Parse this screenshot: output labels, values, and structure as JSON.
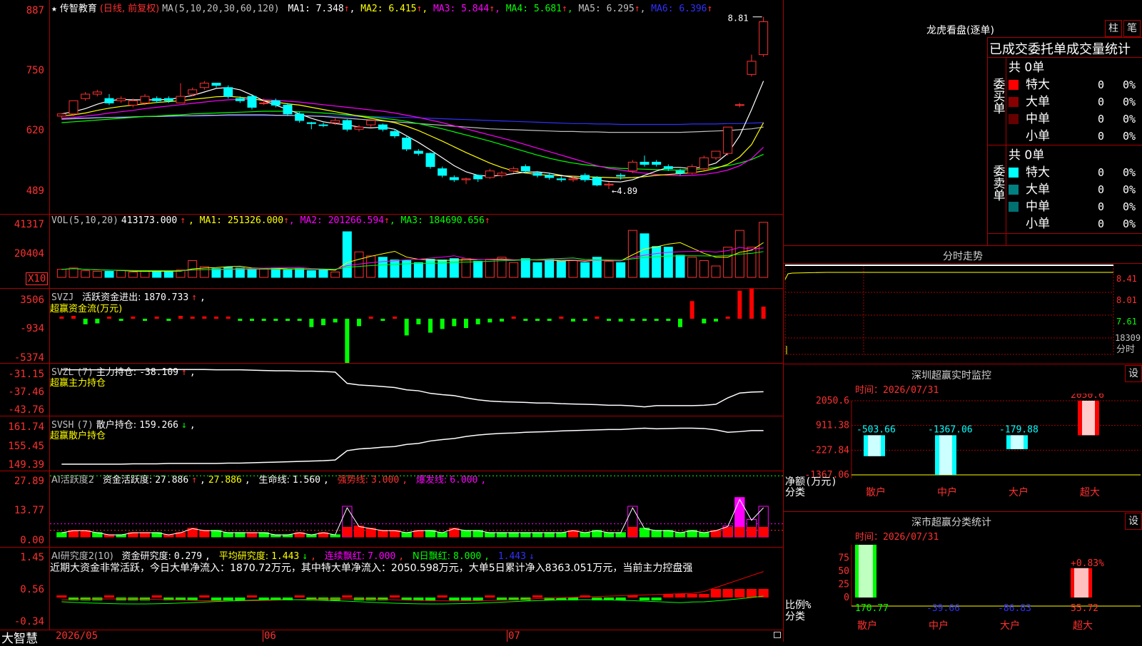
{
  "stock": {
    "star": "★",
    "name": "传智教育",
    "mode": "(日线, 前复权)",
    "ma_params": "MA(5,10,20,30,60,120)",
    "ma": [
      {
        "label": "MA1:",
        "value": "7.348",
        "color": "#ffffff"
      },
      {
        "label": "MA2:",
        "value": "6.415",
        "color": "#ffff00"
      },
      {
        "label": "MA3:",
        "value": "5.844",
        "color": "#ff00ff"
      },
      {
        "label": "MA4:",
        "value": "5.681",
        "color": "#00ff00"
      },
      {
        "label": "MA5:",
        "value": "6.295",
        "color": "#c0c0c0"
      },
      {
        "label": "MA6:",
        "value": "6.396",
        "color": "#3030ff"
      }
    ],
    "up_arrow": "↑",
    "high_label": "8.81",
    "low_label": "←4.89"
  },
  "price_axis": {
    "max_label": "887",
    "labels": [
      "750",
      "620",
      "489"
    ]
  },
  "candles": [
    [
      6.55,
      6.6,
      6.6,
      6.5
    ],
    [
      6.6,
      6.9,
      6.9,
      6.55
    ],
    [
      6.95,
      7.05,
      7.1,
      6.9
    ],
    [
      7.05,
      7.1,
      7.15,
      7.0
    ],
    [
      6.95,
      6.85,
      7.05,
      6.8
    ],
    [
      6.9,
      6.95,
      7.0,
      6.85
    ],
    [
      6.8,
      6.9,
      6.95,
      6.75
    ],
    [
      6.85,
      7.0,
      7.05,
      6.8
    ],
    [
      6.95,
      6.9,
      7.0,
      6.85
    ],
    [
      6.95,
      6.9,
      7.0,
      6.85
    ],
    [
      6.85,
      7.0,
      7.3,
      6.85
    ],
    [
      7.05,
      7.15,
      7.2,
      7.0
    ],
    [
      7.2,
      7.3,
      7.35,
      7.15
    ],
    [
      7.3,
      7.25,
      7.3,
      7.2
    ],
    [
      7.2,
      7.0,
      7.25,
      6.95
    ],
    [
      6.95,
      6.9,
      7.0,
      6.85
    ],
    [
      7.0,
      6.75,
      7.05,
      6.7
    ],
    [
      6.85,
      6.85,
      6.95,
      6.8
    ],
    [
      6.9,
      6.8,
      6.95,
      6.75
    ],
    [
      6.8,
      6.6,
      6.85,
      6.55
    ],
    [
      6.6,
      6.45,
      6.65,
      6.4
    ],
    [
      6.4,
      6.38,
      6.42,
      6.25
    ],
    [
      6.35,
      6.34,
      6.4,
      6.3
    ],
    [
      6.4,
      6.45,
      6.5,
      6.35
    ],
    [
      6.45,
      6.25,
      6.48,
      6.2
    ],
    [
      6.25,
      6.3,
      6.35,
      6.2
    ],
    [
      6.35,
      6.45,
      6.45,
      6.3
    ],
    [
      6.35,
      6.25,
      6.38,
      6.2
    ],
    [
      6.2,
      6.1,
      6.25,
      6.05
    ],
    [
      6.05,
      5.8,
      6.1,
      5.75
    ],
    [
      5.75,
      5.7,
      5.8,
      5.65
    ],
    [
      5.7,
      5.4,
      5.72,
      5.35
    ],
    [
      5.35,
      5.2,
      5.4,
      5.15
    ],
    [
      5.15,
      5.1,
      5.2,
      5.05
    ],
    [
      5.1,
      5.12,
      5.15,
      5.0
    ],
    [
      5.2,
      5.12,
      5.22,
      5.05
    ],
    [
      5.15,
      5.3,
      5.35,
      5.12
    ],
    [
      5.2,
      5.25,
      5.3,
      5.15
    ],
    [
      5.3,
      5.35,
      5.4,
      5.25
    ],
    [
      5.4,
      5.3,
      5.45,
      5.25
    ],
    [
      5.25,
      5.2,
      5.3,
      5.15
    ],
    [
      5.2,
      5.15,
      5.25,
      5.1
    ],
    [
      5.12,
      5.1,
      5.18,
      5.05
    ],
    [
      5.1,
      5.12,
      5.2,
      5.05
    ],
    [
      5.2,
      5.1,
      5.25,
      5.05
    ],
    [
      5.15,
      4.98,
      5.18,
      4.95
    ],
    [
      4.98,
      5.0,
      5.05,
      4.89
    ],
    [
      5.2,
      5.18,
      5.25,
      5.1
    ],
    [
      5.3,
      5.5,
      5.55,
      5.25
    ],
    [
      5.5,
      5.45,
      5.65,
      5.4
    ],
    [
      5.5,
      5.45,
      5.55,
      5.4
    ],
    [
      5.4,
      5.35,
      5.45,
      5.3
    ],
    [
      5.3,
      5.25,
      5.35,
      5.2
    ],
    [
      5.25,
      5.4,
      5.45,
      5.22
    ],
    [
      5.35,
      5.6,
      5.65,
      5.3
    ],
    [
      5.6,
      5.75,
      5.75,
      5.55
    ],
    [
      5.7,
      6.3,
      6.3,
      5.65
    ],
    [
      6.8,
      6.81,
      6.85,
      6.75
    ],
    [
      7.5,
      7.8,
      7.95,
      7.45
    ],
    [
      7.95,
      8.7,
      8.81,
      7.9
    ]
  ],
  "candle_colors": {
    "up": "#ff3030",
    "down": "#00ffff"
  },
  "ma_lines": {
    "ma1": [
      6.6,
      6.65,
      6.72,
      6.82,
      6.9,
      6.93,
      6.92,
      6.92,
      6.92,
      6.93,
      6.97,
      7.02,
      7.1,
      7.18,
      7.2,
      7.15,
      7.03,
      6.9,
      6.8,
      6.7,
      6.6,
      6.5,
      6.42,
      6.38,
      6.35,
      6.3,
      6.28,
      6.3,
      6.25,
      6.1,
      5.95,
      5.78,
      5.6,
      5.42,
      5.28,
      5.2,
      5.18,
      5.2,
      5.24,
      5.27,
      5.28,
      5.25,
      5.2,
      5.15,
      5.12,
      5.09,
      5.06,
      5.05,
      5.1,
      5.2,
      5.3,
      5.38,
      5.38,
      5.35,
      5.4,
      5.48,
      5.7,
      6.1,
      6.7,
      7.35
    ],
    "ma2": [
      6.55,
      6.58,
      6.62,
      6.68,
      6.73,
      6.77,
      6.8,
      6.83,
      6.86,
      6.88,
      6.9,
      6.93,
      6.96,
      6.99,
      7.0,
      6.98,
      6.95,
      6.9,
      6.87,
      6.83,
      6.8,
      6.75,
      6.7,
      6.65,
      6.6,
      6.55,
      6.5,
      6.45,
      6.4,
      6.32,
      6.22,
      6.1,
      5.98,
      5.85,
      5.72,
      5.6,
      5.48,
      5.38,
      5.3,
      5.25,
      5.22,
      5.2,
      5.19,
      5.18,
      5.17,
      5.16,
      5.15,
      5.14,
      5.15,
      5.17,
      5.2,
      5.22,
      5.24,
      5.26,
      5.3,
      5.36,
      5.45,
      5.62,
      5.9,
      6.4
    ],
    "ma3": [
      6.5,
      6.52,
      6.55,
      6.58,
      6.62,
      6.65,
      6.68,
      6.72,
      6.75,
      6.78,
      6.81,
      6.84,
      6.87,
      6.9,
      6.92,
      6.93,
      6.93,
      6.92,
      6.91,
      6.89,
      6.87,
      6.84,
      6.81,
      6.78,
      6.75,
      6.72,
      6.69,
      6.66,
      6.62,
      6.57,
      6.52,
      6.46,
      6.4,
      6.33,
      6.26,
      6.19,
      6.12,
      6.05,
      5.98,
      5.9,
      5.82,
      5.74,
      5.66,
      5.58,
      5.5,
      5.42,
      5.36,
      5.32,
      5.28,
      5.25,
      5.22,
      5.2,
      5.19,
      5.2,
      5.22,
      5.26,
      5.32,
      5.42,
      5.58,
      5.84
    ],
    "ma4": [
      6.4,
      6.42,
      6.44,
      6.46,
      6.48,
      6.5,
      6.52,
      6.54,
      6.55,
      6.57,
      6.58,
      6.6,
      6.61,
      6.62,
      6.63,
      6.64,
      6.65,
      6.66,
      6.66,
      6.66,
      6.65,
      6.64,
      6.62,
      6.6,
      6.58,
      6.56,
      6.53,
      6.5,
      6.47,
      6.43,
      6.38,
      6.32,
      6.26,
      6.19,
      6.12,
      6.05,
      5.98,
      5.9,
      5.82,
      5.74,
      5.66,
      5.59,
      5.53,
      5.48,
      5.44,
      5.41,
      5.38,
      5.36,
      5.35,
      5.34,
      5.33,
      5.32,
      5.32,
      5.33,
      5.35,
      5.38,
      5.42,
      5.48,
      5.56,
      5.68
    ],
    "ma5": [
      6.48,
      6.49,
      6.5,
      6.51,
      6.52,
      6.52,
      6.53,
      6.54,
      6.54,
      6.55,
      6.56,
      6.56,
      6.57,
      6.57,
      6.58,
      6.58,
      6.58,
      6.58,
      6.57,
      6.57,
      6.56,
      6.55,
      6.54,
      6.52,
      6.5,
      6.48,
      6.46,
      6.44,
      6.42,
      6.4,
      6.38,
      6.36,
      6.34,
      6.32,
      6.3,
      6.28,
      6.26,
      6.25,
      6.24,
      6.23,
      6.22,
      6.21,
      6.2,
      6.2,
      6.19,
      6.19,
      6.18,
      6.18,
      6.18,
      6.18,
      6.18,
      6.18,
      6.18,
      6.19,
      6.2,
      6.21,
      6.22,
      6.24,
      6.26,
      6.3
    ],
    "ma6": [
      6.5,
      6.51,
      6.51,
      6.52,
      6.52,
      6.53,
      6.53,
      6.54,
      6.54,
      6.54,
      6.55,
      6.55,
      6.55,
      6.56,
      6.56,
      6.56,
      6.56,
      6.56,
      6.56,
      6.56,
      6.56,
      6.56,
      6.55,
      6.55,
      6.55,
      6.54,
      6.54,
      6.53,
      6.52,
      6.52,
      6.51,
      6.5,
      6.49,
      6.48,
      6.47,
      6.46,
      6.45,
      6.44,
      6.43,
      6.42,
      6.41,
      6.4,
      6.39,
      6.38,
      6.38,
      6.37,
      6.37,
      6.36,
      6.36,
      6.36,
      6.36,
      6.36,
      6.36,
      6.37,
      6.37,
      6.37,
      6.38,
      6.38,
      6.39,
      6.4
    ]
  },
  "vol": {
    "params": "VOL(5,10,20)",
    "value": "413173.000",
    "ma": [
      {
        "label": "MA1:",
        "value": "251326.000",
        "color": "#ffff00"
      },
      {
        "label": "MA2:",
        "value": "201266.594",
        "color": "#ff00ff"
      },
      {
        "label": "MA3:",
        "value": "184690.656",
        "color": "#00ff00"
      }
    ],
    "axis": [
      "41317",
      "20404"
    ],
    "unit": "X10",
    "bars": [
      12,
      14,
      10,
      9,
      9,
      10,
      8,
      9,
      10,
      8,
      11,
      25,
      16,
      13,
      15,
      14,
      12,
      13,
      14,
      11,
      13,
      10,
      11,
      8,
      68,
      38,
      32,
      30,
      26,
      25,
      22,
      27,
      26,
      28,
      28,
      24,
      27,
      30,
      22,
      28,
      22,
      27,
      24,
      25,
      22,
      30,
      24,
      22,
      70,
      65,
      46,
      45,
      33,
      30,
      25,
      17,
      45,
      70,
      45,
      82
    ]
  },
  "svzj": {
    "name": "SVZJ",
    "label": "活跃资金进出:",
    "value": "1870.733",
    "suffix": ",",
    "sub": "超赢资金流(万元)",
    "axis": [
      "3506",
      "-934",
      "-5374"
    ],
    "values": [
      200,
      300,
      -600,
      -500,
      100,
      -200,
      150,
      -100,
      150,
      -200,
      300,
      150,
      250,
      200,
      150,
      -200,
      -150,
      -100,
      -100,
      -100,
      -50,
      -900,
      -700,
      -400,
      -5000,
      -800,
      200,
      -200,
      200,
      -1800,
      -600,
      -1500,
      -1100,
      -800,
      -1000,
      -600,
      -400,
      -300,
      100,
      -200,
      -100,
      -200,
      150,
      -300,
      -150,
      200,
      -200,
      -300,
      -100,
      -100,
      -150,
      -100,
      -900,
      1900,
      -500,
      -300,
      100,
      3000,
      3800,
      1300,
      -400,
      2000
    ]
  },
  "svzl": {
    "name": "SVZL",
    "params": "(7)",
    "label": "主力持仓:",
    "value": "-38.109",
    "sub": "超赢主力持仓",
    "axis": [
      "-31.15",
      "-37.46",
      "-43.76"
    ],
    "values": [
      -31.3,
      -31.3,
      -31.3,
      -31.3,
      -31.3,
      -31.3,
      -31.3,
      -31.3,
      -31.3,
      -31.2,
      -31.2,
      -31.2,
      -31.2,
      -31.3,
      -31.3,
      -31.3,
      -31.4,
      -31.5,
      -31.6,
      -31.6,
      -31.7,
      -31.7,
      -31.8,
      -32.0,
      -35.5,
      -36.0,
      -36.2,
      -36.5,
      -36.8,
      -37.5,
      -37.8,
      -38.6,
      -39.0,
      -39.3,
      -40.0,
      -40.6,
      -41.0,
      -41.2,
      -41.3,
      -41.4,
      -41.6,
      -41.6,
      -41.8,
      -41.9,
      -42.0,
      -42.1,
      -42.3,
      -42.3,
      -42.5,
      -42.8,
      -42.4,
      -42.4,
      -42.4,
      -42.4,
      -42.3,
      -42.0,
      -40.0,
      -38.5,
      -38.2,
      -38.1
    ]
  },
  "svsh": {
    "name": "SVSH",
    "params": "(7)",
    "label": "散户持仓:",
    "value": "159.266",
    "sub": "超赢散户持仓",
    "axis": [
      "161.74",
      "155.45",
      "149.39"
    ],
    "values": [
      149.6,
      149.6,
      149.6,
      149.6,
      149.6,
      149.6,
      149.7,
      149.7,
      149.7,
      149.8,
      149.8,
      149.8,
      149.8,
      149.8,
      149.9,
      149.9,
      150.0,
      150.1,
      150.2,
      150.3,
      150.4,
      150.5,
      150.6,
      150.8,
      153.5,
      154.0,
      154.2,
      154.5,
      154.7,
      155.3,
      155.6,
      156.3,
      156.7,
      157.0,
      157.6,
      158.0,
      158.3,
      158.5,
      158.6,
      158.8,
      158.9,
      159.0,
      159.2,
      159.3,
      159.4,
      159.5,
      159.6,
      159.6,
      159.8,
      160.0,
      159.8,
      159.9,
      160.0,
      160.0,
      159.9,
      159.5,
      158.8,
      159.0,
      159.3,
      159.3
    ]
  },
  "ai_active": {
    "name": "AI活跃度2",
    "label": "资金活跃度:",
    "value1": "27.886",
    "value2": "27.886",
    "life_label": "生命线:",
    "life_value": "1.560",
    "strong_label": "强势线:",
    "strong_value": "3.000",
    "burst_label": "爆发线:",
    "burst_value": "6.000",
    "axis": [
      "27.89",
      "13.77",
      "0.00"
    ],
    "values": [
      2,
      3,
      3,
      2,
      1,
      1,
      2,
      2,
      2,
      1,
      2,
      4,
      3,
      3,
      2,
      2,
      2,
      2,
      1,
      1,
      2,
      1,
      2,
      1,
      14,
      5,
      4,
      3,
      3,
      2,
      3,
      3,
      2,
      4,
      3,
      3,
      2,
      2,
      2,
      2,
      2,
      2,
      2,
      3,
      2,
      3,
      2,
      2,
      14,
      4,
      3,
      3,
      2,
      3,
      2,
      3,
      5,
      18,
      8,
      14,
      28
    ],
    "mode": [
      0,
      1,
      1,
      0,
      1,
      0,
      1,
      1,
      0,
      1,
      1,
      1,
      1,
      0,
      0,
      0,
      1,
      0,
      0,
      0,
      1,
      0,
      1,
      0,
      2,
      1,
      1,
      1,
      1,
      0,
      1,
      0,
      0,
      1,
      0,
      0,
      0,
      0,
      0,
      0,
      0,
      0,
      0,
      1,
      0,
      0,
      0,
      0,
      2,
      0,
      0,
      0,
      0,
      0,
      0,
      1,
      2,
      2,
      2,
      2,
      2
    ]
  },
  "ai_research": {
    "name": "AI研究度2(10)",
    "label": "资金研究度:",
    "value": "0.279",
    "avg_label": "平均研究度:",
    "avg_value": "1.443",
    "red_label": "连续飘红:",
    "red_value": "7.000",
    "nred_label": "N日飘红:",
    "nred_value": "8.000",
    "tail_value": "1.443",
    "down_arrow": "↓",
    "comment": "近期大资金非常活跃，今日大单净流入：1870.72万元，其中特大单净流入：2050.598万元，大单5日累计净入8363.051万元，当前主力控盘强",
    "axis": [
      "1.45",
      "0.56",
      "-0.34"
    ]
  },
  "bottom_bar": {
    "brand": "大智慧",
    "dates": [
      "2026/05",
      "06",
      "07"
    ]
  },
  "right_panel": {
    "buttons": [
      "柱",
      "笔"
    ],
    "title": "龙虎看盘(逐单)",
    "stats_title": "已成交委托单成交量统计",
    "buy": {
      "side_label": "委买单",
      "total": "共 0单",
      "rows": [
        {
          "name": "特大",
          "count": "0",
          "pct": "0%",
          "color": "#ff0000"
        },
        {
          "name": "大单",
          "count": "0",
          "pct": "0%",
          "color": "#880000"
        },
        {
          "name": "中单",
          "count": "0",
          "pct": "0%",
          "color": "#660000"
        },
        {
          "name": "小单",
          "count": "0",
          "pct": "0%",
          "color": ""
        }
      ]
    },
    "sell": {
      "side_label": "委卖单",
      "total": "共 0单",
      "rows": [
        {
          "name": "特大",
          "count": "0",
          "pct": "0%",
          "color": "#00ffff"
        },
        {
          "name": "大单",
          "count": "0",
          "pct": "0%",
          "color": "#008080"
        },
        {
          "name": "中单",
          "count": "0",
          "pct": "0%",
          "color": "#007070"
        },
        {
          "name": "小单",
          "count": "0",
          "pct": "0%",
          "color": ""
        }
      ]
    },
    "timeshare": {
      "title": "分时走势",
      "labels": [
        "8.41",
        "8.01",
        "7.61"
      ],
      "vol_label": "18309",
      "time_label": "分时"
    },
    "sz_monitor": {
      "title": "深圳超赢实时监控",
      "set": "设",
      "time": "时间：2026/07/31",
      "axis": [
        "2050.6",
        "911.38",
        "-227.84",
        "-1367.06"
      ],
      "ylabel1": "净额(万元)",
      "ylabel2": "分类",
      "categories": [
        "散户",
        "中户",
        "大户",
        "超大"
      ],
      "values": [
        -503.66,
        -1367.06,
        -179.88,
        2050.6
      ],
      "value_labels": [
        "-503.66",
        "-1367.06",
        "-179.88",
        "2050.6"
      ]
    },
    "sz_class": {
      "title": "深市超赢分类统计",
      "set": "设",
      "time": "时间：2026/07/31",
      "axis": [
        "75",
        "50",
        "25",
        "0"
      ],
      "ylabel1": "比例%",
      "ylabel2": "分类",
      "categories": [
        "散户",
        "中户",
        "大户",
        "超大"
      ],
      "bar_pct": [
        100,
        0,
        0,
        55.72
      ],
      "top_label": "+0.83%",
      "value_labels": [
        "170.77",
        "-39.66",
        "-86.83",
        "55.72"
      ]
    }
  }
}
